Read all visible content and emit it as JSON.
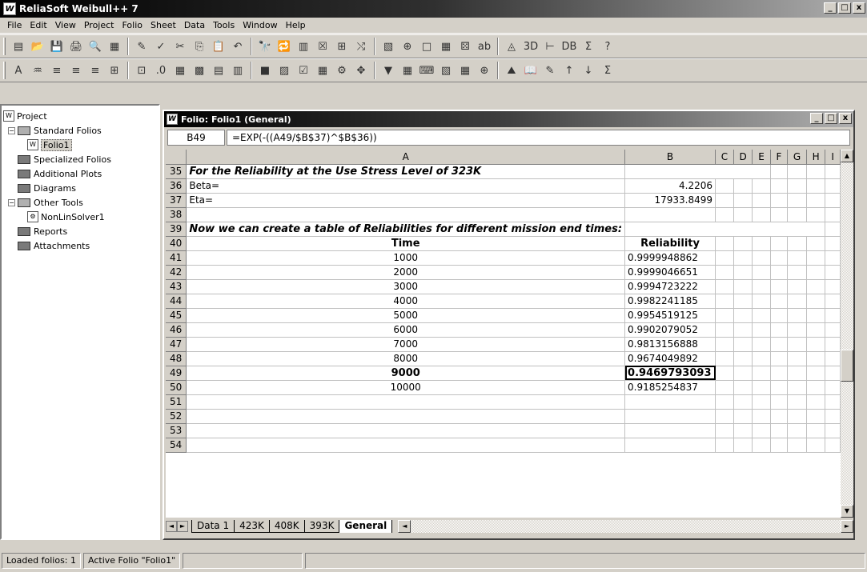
{
  "app": {
    "title": "ReliaSoft Weibull++ 7",
    "icon": "W"
  },
  "window_controls": {
    "minimize": "_",
    "maximize": "□",
    "close": "x"
  },
  "menu": [
    "File",
    "Edit",
    "View",
    "Project",
    "Folio",
    "Sheet",
    "Data",
    "Tools",
    "Window",
    "Help"
  ],
  "toolbar1": [
    "new-icon",
    "open-icon",
    "save-icon",
    "print-icon",
    "preview-icon",
    "properties-icon",
    "spell-icon",
    "check-icon",
    "cut-icon",
    "copy-icon",
    "paste-icon",
    "undo-icon",
    "find-icon",
    "replace-icon",
    "table-icon",
    "plot-icon",
    "calc-icon",
    "transform-icon",
    "chart-icon",
    "grid-icon",
    "box-icon",
    "grid2-icon",
    "dice-icon",
    "abc-icon",
    "area-icon",
    "3d-icon",
    "bracket-icon",
    "dbt-icon",
    "sigma-x-icon",
    "help-icon"
  ],
  "toolbar2": [
    "font-color-icon",
    "fill-icon",
    "align-left-icon",
    "align-center-icon",
    "align-right-icon",
    "merge-icon",
    "border-icon",
    "decimal-icon",
    "table-insert-icon",
    "table-edit-icon",
    "sheet-icon",
    "sheet2-icon",
    "sheet3-icon",
    "plot2-icon",
    "plot3-icon",
    "gcp-icon",
    "image-icon",
    "diamond-icon",
    "funnel-icon",
    "layout-icon",
    "keyboard-icon",
    "chart2-icon",
    "grid3-icon",
    "move-icon",
    "cone-icon",
    "book-icon",
    "edit-icon",
    "sort-asc-icon",
    "sort-desc-icon",
    "sum-icon"
  ],
  "toolbar1_glyphs": [
    "▤",
    "📂",
    "💾",
    "🖨",
    "🔍",
    "▦",
    "✎",
    "✓",
    "✂",
    "⎘",
    "📋",
    "↶",
    "🔭",
    "🔁",
    "▥",
    "☒",
    "⊞",
    "⤭",
    "▧",
    "⊕",
    "□",
    "▦",
    "⚄",
    "ab",
    "◬",
    "3D",
    "⊢",
    "DB",
    "Σ",
    "?"
  ],
  "toolbar2_glyphs": [
    "A",
    "♒",
    "≡",
    "≡",
    "≡",
    "⊞",
    "⊡",
    ".0",
    "▦",
    "▩",
    "▤",
    "▥",
    "■",
    "▨",
    "☑",
    "▦",
    "⚙",
    "✥",
    "▼",
    "▦",
    "⌨",
    "▧",
    "▦",
    "⊕",
    "⛰",
    "📖",
    "✎",
    "↑",
    "↓",
    "Σ"
  ],
  "tree": {
    "root": "Project",
    "items": [
      {
        "label": "Standard Folios",
        "level": 1,
        "type": "folder-open",
        "toggle": "−"
      },
      {
        "label": "Folio1",
        "level": 2,
        "type": "folio",
        "selected": true
      },
      {
        "label": "Specialized Folios",
        "level": 1,
        "type": "folder"
      },
      {
        "label": "Additional Plots",
        "level": 1,
        "type": "folder"
      },
      {
        "label": "Diagrams",
        "level": 1,
        "type": "folder"
      },
      {
        "label": "Other Tools",
        "level": 1,
        "type": "folder-open",
        "toggle": "−"
      },
      {
        "label": "NonLinSolver1",
        "level": 2,
        "type": "tool"
      },
      {
        "label": "Reports",
        "level": 1,
        "type": "folder"
      },
      {
        "label": "Attachments",
        "level": 1,
        "type": "folder"
      }
    ]
  },
  "folio": {
    "title": "Folio: Folio1 (General)",
    "cell_ref": "B49",
    "formula": "=EXP(-((A49/$B$37)^$B$36))",
    "columns": [
      "A",
      "B",
      "C",
      "D",
      "E",
      "F",
      "G",
      "H",
      "I"
    ],
    "rows": [
      {
        "n": "35",
        "A": "For the Reliability at the Use Stress Level of 323K",
        "B": "",
        "style": "span-bi"
      },
      {
        "n": "36",
        "A": "Beta=",
        "B": "4.2206"
      },
      {
        "n": "37",
        "A": "Eta=",
        "B": "17933.8499"
      },
      {
        "n": "38",
        "A": "",
        "B": ""
      },
      {
        "n": "39",
        "A": "Now we can create a table of Reliabilities for different mission end times:",
        "B": "",
        "style": "span-bi"
      },
      {
        "n": "40",
        "A": "Time",
        "B": "Reliability",
        "style": "header"
      },
      {
        "n": "41",
        "A": "1000",
        "B": "0.9999948862"
      },
      {
        "n": "42",
        "A": "2000",
        "B": "0.9999046651"
      },
      {
        "n": "43",
        "A": "3000",
        "B": "0.9994723222"
      },
      {
        "n": "44",
        "A": "4000",
        "B": "0.9982241185"
      },
      {
        "n": "45",
        "A": "5000",
        "B": "0.9954519125"
      },
      {
        "n": "46",
        "A": "6000",
        "B": "0.9902079052"
      },
      {
        "n": "47",
        "A": "7000",
        "B": "0.9813156888"
      },
      {
        "n": "48",
        "A": "8000",
        "B": "0.9674049892"
      },
      {
        "n": "49",
        "A": "9000",
        "B": "0.9469793093",
        "style": "active"
      },
      {
        "n": "50",
        "A": "10000",
        "B": "0.9185254837"
      },
      {
        "n": "51",
        "A": "",
        "B": ""
      },
      {
        "n": "52",
        "A": "",
        "B": ""
      },
      {
        "n": "53",
        "A": "",
        "B": ""
      },
      {
        "n": "54",
        "A": "",
        "B": ""
      }
    ],
    "tabs": [
      {
        "label": "Data 1",
        "active": false
      },
      {
        "label": "423K",
        "active": false
      },
      {
        "label": "408K",
        "active": false
      },
      {
        "label": "393K",
        "active": false
      },
      {
        "label": "General",
        "active": true
      }
    ]
  },
  "scroll": {
    "up": "▲",
    "down": "▼",
    "left": "◄",
    "right": "►",
    "first": "◄",
    "next": "►"
  },
  "status": {
    "loaded": "Loaded folios: 1",
    "active": "Active Folio \"Folio1\""
  }
}
